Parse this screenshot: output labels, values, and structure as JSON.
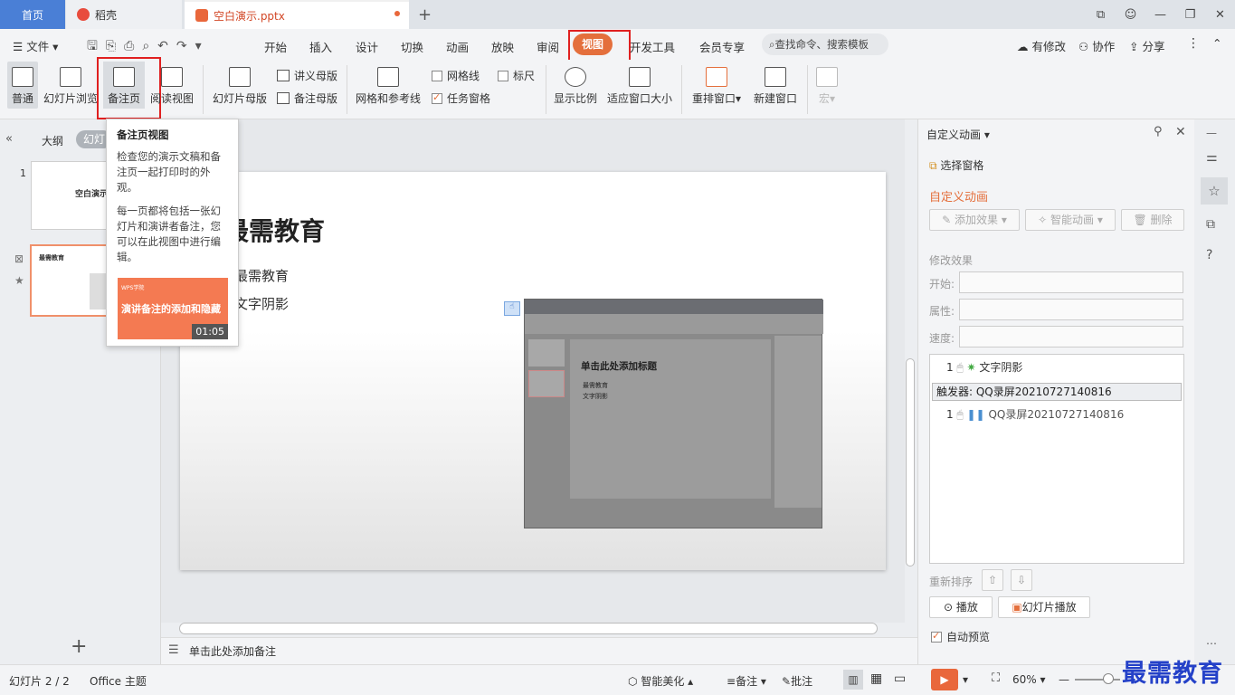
{
  "tabs": {
    "home": "首页",
    "daoke": "稻壳",
    "file": "空白演示.pptx"
  },
  "menu": {
    "file": "文件",
    "items": [
      "开始",
      "插入",
      "设计",
      "切换",
      "动画",
      "放映",
      "审阅",
      "视图",
      "开发工具",
      "会员专享"
    ],
    "search": "查找命令、搜索模板",
    "right": [
      "有修改",
      "协作",
      "分享"
    ]
  },
  "ribbon": {
    "normal": "普通",
    "browse": "幻灯片浏览",
    "notes_page": "备注页",
    "reading": "阅读视图",
    "slide_master": "幻灯片母版",
    "handout_master": "讲义母版",
    "notes_master": "备注母版",
    "grid_guides": "网格和参考线",
    "gridlines": "网格线",
    "ruler": "标尺",
    "task_pane": "任务窗格",
    "zoom": "显示比例",
    "fit": "适应窗口大小",
    "arrange": "重排窗口",
    "new_window": "新建窗口",
    "macro": "宏"
  },
  "leftpane": {
    "outline": "大纲",
    "slides": "幻灯片",
    "slide1_num": "1",
    "slide2_num": "2",
    "slide1_title": "空白演示",
    "slide2_title": "最需教育"
  },
  "tooltip": {
    "title": "备注页视图",
    "p1": "检查您的演示文稿和备注页一起打印时的外观。",
    "p2": "每一页都将包括一张幻灯片和演讲者备注，您可以在此视图中进行编辑。",
    "video_title": "演讲备注的添加和隐藏",
    "video_time": "01:05",
    "video_brand": "WPS学院"
  },
  "slide": {
    "title": "最需教育",
    "bullet1": "最需教育",
    "bullet2": "文字阴影",
    "embed_title": "单击此处添加标题",
    "embed_b1": "最需教育",
    "embed_b2": "文字阴影"
  },
  "notes": {
    "placeholder": "单击此处添加备注"
  },
  "rpanel": {
    "header": "自定义动画",
    "select_pane": "选择窗格",
    "section": "自定义动画",
    "add_effect": "添加效果",
    "smart_anim": "智能动画",
    "delete": "删除",
    "modify": "修改效果",
    "start": "开始:",
    "property": "属性:",
    "speed": "速度:",
    "item1_num": "1",
    "item1": "文字阴影",
    "trigger": "触发器: QQ录屏20210727140816",
    "item2_num": "1",
    "item2": "QQ录屏20210727140816",
    "reorder": "重新排序",
    "play": "播放",
    "slideshow": "幻灯片播放",
    "autopreview": "自动预览"
  },
  "status": {
    "slide": "幻灯片 2 / 2",
    "theme": "Office 主题",
    "beautify": "智能美化",
    "notes": "备注",
    "comments": "批注",
    "zoom": "60%"
  },
  "watermark": "最需教育",
  "colors": {
    "accent": "#e46f3c",
    "highlight": "#e02020",
    "home_tab": "#4a7fd6"
  }
}
